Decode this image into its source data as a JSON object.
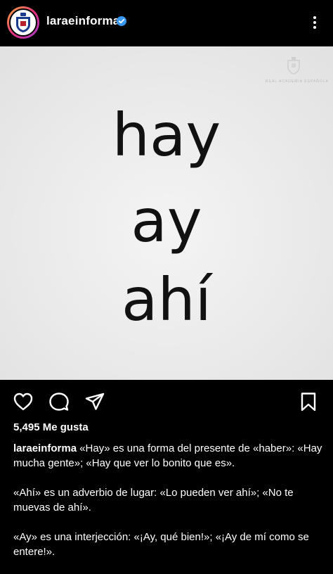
{
  "header": {
    "username": "laraeinforma",
    "verified_icon": "verified-badge-icon",
    "more_icon": "more-vertical-icon",
    "accent": "#3897f0"
  },
  "post": {
    "words": [
      "hay",
      "ay",
      "ahí"
    ],
    "logo_icon": "rae-crest-icon",
    "background": "#e9e9e9",
    "text_color": "#111111"
  },
  "actions": {
    "like_icon": "heart-icon",
    "comment_icon": "comment-icon",
    "share_icon": "send-icon",
    "save_icon": "bookmark-icon"
  },
  "likes": "5,495 Me gusta",
  "caption": {
    "username": "laraeinforma",
    "paragraph1": " «Hay» es una forma del presente de «haber»: «Hay mucha gente»; «Hay que ver lo bonito que es».",
    "paragraph2": "«Ahí» es un adverbio de lugar: «Lo pueden ver ahí»; «No te muevas de ahí».",
    "paragraph3": "«Ay» es una interjección: «¡Ay, qué bien!»; «¡Ay de mí como se entere!»."
  }
}
